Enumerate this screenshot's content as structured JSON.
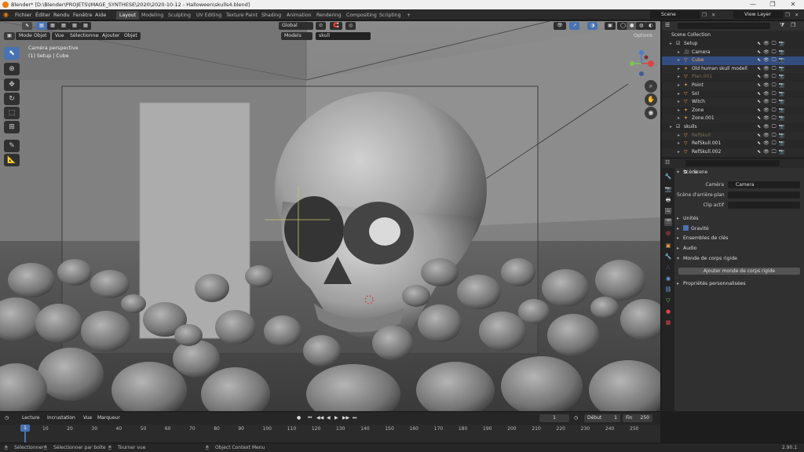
{
  "window": {
    "title": "Blender* [D:\\Blender\\PROJETS\\IMAGE_SYNTHESE\\2020\\2020-10-12 - Halloween\\skulls4.blend]",
    "minimize": "—",
    "maximize": "❐",
    "close": "✕"
  },
  "menu": [
    "Fichier",
    "Éditer",
    "Rendu",
    "Fenêtre",
    "Aide"
  ],
  "workspaces": [
    "Layout",
    "Modeling",
    "Sculpting",
    "UV Editing",
    "Texture Paint",
    "Shading",
    "Animation",
    "Rendering",
    "Compositing",
    "Scripting"
  ],
  "active_workspace": "Layout",
  "scene_field": "Scene",
  "view_layer_field": "View Layer",
  "viewport": {
    "mode": "Mode Objet",
    "menus": [
      "Vue",
      "Sélectionner",
      "Ajouter",
      "Objet"
    ],
    "orientation": "Global",
    "models_dropdown": "Models",
    "search_value": "skull",
    "options": "Options",
    "overlay_title": "Caméra perspective",
    "overlay_subtitle": "(1) Setup | Cube"
  },
  "outliner": {
    "root": "Scene Collection",
    "rows": [
      {
        "name": "Setup",
        "color": "#dddddd",
        "indent": 1,
        "icon": "collection-icon"
      },
      {
        "name": "Camera",
        "color": "#dddddd",
        "indent": 2,
        "icon": "camera-icon"
      },
      {
        "name": "Cube",
        "color": "#f2a85a",
        "indent": 2,
        "icon": "mesh-icon",
        "selected": true
      },
      {
        "name": "Old human skull modell",
        "color": "#dddddd",
        "indent": 2,
        "icon": "armature-icon"
      },
      {
        "name": "Plan.001",
        "color": "#7a6d5a",
        "indent": 2,
        "icon": "mesh-icon"
      },
      {
        "name": "Point",
        "color": "#dddddd",
        "indent": 2,
        "icon": "light-icon"
      },
      {
        "name": "Sol",
        "color": "#dddddd",
        "indent": 2,
        "icon": "mesh-icon"
      },
      {
        "name": "Witch",
        "color": "#dddddd",
        "indent": 2,
        "icon": "mesh-icon"
      },
      {
        "name": "Zone",
        "color": "#dddddd",
        "indent": 2,
        "icon": "light-icon"
      },
      {
        "name": "Zone.001",
        "color": "#dddddd",
        "indent": 2,
        "icon": "light-icon"
      },
      {
        "name": "skulls",
        "color": "#dddddd",
        "indent": 1,
        "icon": "collection-icon"
      },
      {
        "name": "RefSkull",
        "color": "#7a6d5a",
        "indent": 2,
        "icon": "mesh-icon"
      },
      {
        "name": "RefSkull.001",
        "color": "#dddddd",
        "indent": 2,
        "icon": "mesh-icon"
      },
      {
        "name": "RefSkull.002",
        "color": "#dddddd",
        "indent": 2,
        "icon": "mesh-icon"
      }
    ]
  },
  "properties": {
    "context": "Scene",
    "section_scene": "Scène",
    "camera_label": "Caméra",
    "camera_value": "Camera",
    "background_label": "Scène d'arrière-plan",
    "clip_label": "Clip actif",
    "sections": [
      "Unités",
      "Gravité",
      "Ensembles de clés",
      "Audio",
      "Monde de corps rigide"
    ],
    "add_rigid_world": "Ajouter monde de corps rigide",
    "custom_props": "Propriétés personnalisées"
  },
  "timeline": {
    "menus": [
      "Lecture",
      "Incrustation",
      "Vue",
      "Marqueur"
    ],
    "current_frame": "1",
    "start_label": "Début",
    "start_value": "1",
    "end_label": "Fin",
    "end_value": "250",
    "current_marker": "1",
    "ticks": [
      "10",
      "20",
      "30",
      "40",
      "50",
      "60",
      "70",
      "80",
      "90",
      "100",
      "110",
      "120",
      "130",
      "140",
      "150",
      "160",
      "170",
      "180",
      "190",
      "200",
      "210",
      "220",
      "230",
      "240",
      "250"
    ]
  },
  "status": {
    "select": "Sélectionner",
    "box_select": "Sélectionner par boîte",
    "rotate_view": "Tourner vue",
    "context_menu": "Object Context Menu",
    "version": "2.90.1"
  },
  "colors": {
    "accent": "#4772b3",
    "selected_row": "#334d80",
    "active_object": "#f2a85a"
  }
}
